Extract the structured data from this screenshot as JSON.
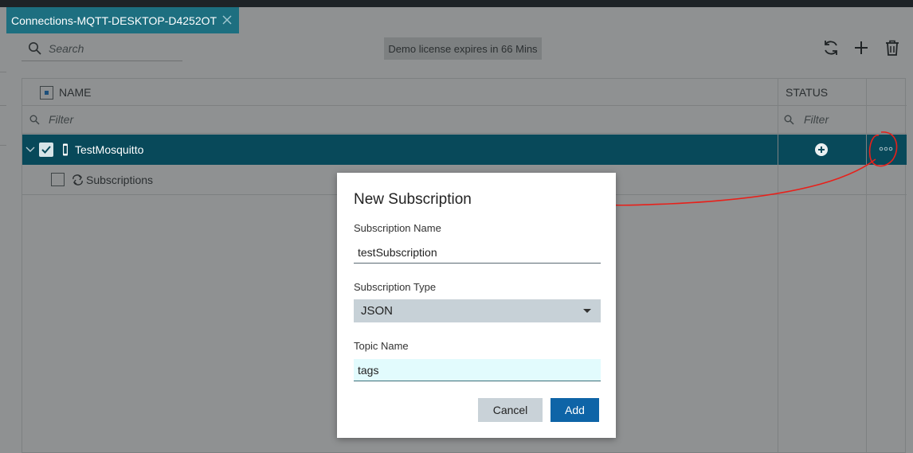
{
  "tab": {
    "title": "Connections-MQTT-DESKTOP-D4252OT"
  },
  "search": {
    "placeholder": "Search"
  },
  "license": {
    "text": "Demo license expires in 66 Mins"
  },
  "grid": {
    "columns": {
      "name": "NAME",
      "status": "STATUS"
    },
    "filter_placeholder": "Filter",
    "rows": [
      {
        "label": "TestMosquitto",
        "checked": true,
        "expanded": true,
        "selected": true
      },
      {
        "label": "Subscriptions",
        "checked": false
      }
    ]
  },
  "dialog": {
    "title": "New Subscription",
    "fields": {
      "name_label": "Subscription Name",
      "name_value": "testSubscription",
      "type_label": "Subscription Type",
      "type_value": "JSON",
      "topic_label": "Topic Name",
      "topic_value": "tags"
    },
    "buttons": {
      "cancel": "Cancel",
      "add": "Add"
    }
  },
  "icons": {
    "tab_close": "close-icon",
    "search": "search-icon",
    "refresh": "refresh-icon",
    "add": "plus-icon",
    "delete": "trash-icon",
    "row_add": "plus-circle-icon",
    "row_more": "more-icon",
    "device": "device-icon",
    "subscription": "sync-icon",
    "expand": "chevron-down-icon"
  },
  "colors": {
    "tab_bg": "#1d6f80",
    "selected_row": "#08495a",
    "primary_button": "#0e64a7",
    "annotation": "#e8201a"
  }
}
